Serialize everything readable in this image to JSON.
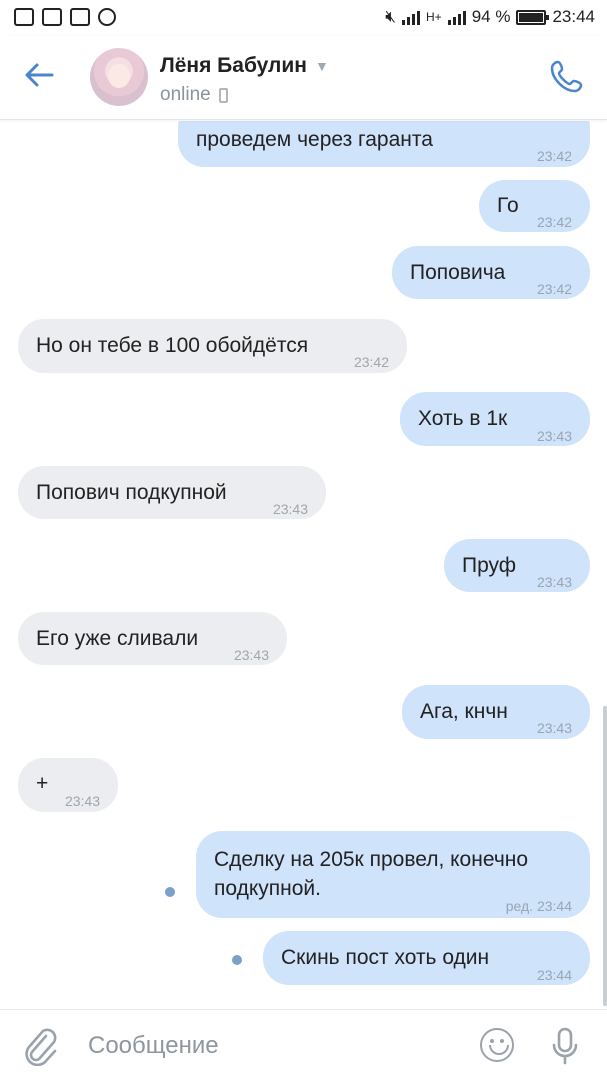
{
  "statusbar": {
    "network": "H+",
    "battery": "94 %",
    "time": "23:44"
  },
  "header": {
    "contact_name": "Лёня Бабулин",
    "status": "online"
  },
  "messages": [
    {
      "dir": "out",
      "text": "проведем через гаранта",
      "time": "23:42"
    },
    {
      "dir": "out",
      "text": "Го",
      "time": "23:42"
    },
    {
      "dir": "out",
      "text": "Поповича",
      "time": "23:42"
    },
    {
      "dir": "in",
      "text": "Но он тебе в 100 обойдётся",
      "time": "23:42"
    },
    {
      "dir": "out",
      "text": "Хоть в 1к",
      "time": "23:43"
    },
    {
      "dir": "in",
      "text": "Попович подкупной",
      "time": "23:43"
    },
    {
      "dir": "out",
      "text": "Пруф",
      "time": "23:43"
    },
    {
      "dir": "in",
      "text": "Его уже сливали",
      "time": "23:43"
    },
    {
      "dir": "out",
      "text": "Ага, кнчн",
      "time": "23:43"
    },
    {
      "dir": "in",
      "text": "+",
      "time": "23:43"
    },
    {
      "dir": "out",
      "text_line1": "Сделку на 205к провел, конечно",
      "text_line2": "подкупной.",
      "time": "ред. 23:44",
      "unread": true
    },
    {
      "dir": "out",
      "text": "Скинь пост хоть один",
      "time": "23:44",
      "unread": true
    }
  ],
  "composer": {
    "placeholder": "Сообщение"
  },
  "colors": {
    "accent": "#4986cc",
    "outgoing_bubble": "#cfe3fb",
    "incoming_bubble": "#ebedf0"
  },
  "icons": [
    "back-arrow-icon",
    "phone-icon",
    "attach-icon",
    "emoji-icon",
    "microphone-icon"
  ]
}
